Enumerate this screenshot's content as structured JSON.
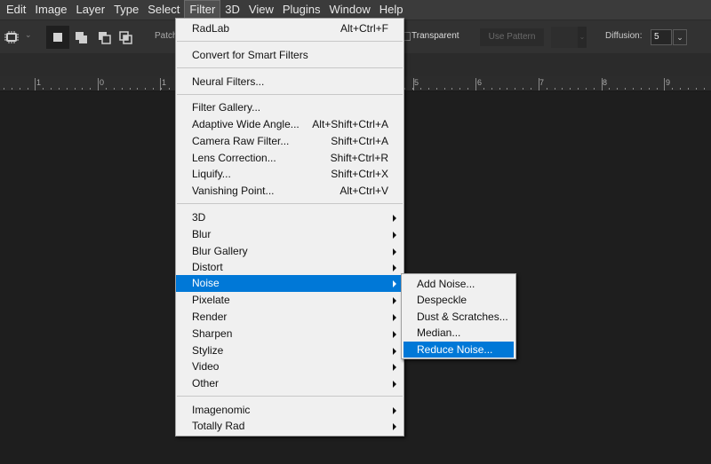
{
  "menubar": {
    "items": [
      "Edit",
      "Image",
      "Layer",
      "Type",
      "Select",
      "Filter",
      "3D",
      "View",
      "Plugins",
      "Window",
      "Help"
    ],
    "active": "Filter"
  },
  "options_bar": {
    "tool_icon": "patch-tool-icon",
    "selection_modes": [
      "new-selection",
      "add-to-selection",
      "subtract-from-selection",
      "intersect-with-selection"
    ],
    "patch_label": "Patch",
    "transparent_label": "Transparent",
    "transparent_checked": false,
    "use_pattern_label": "Use Pattern",
    "diffusion_label": "Diffusion:",
    "diffusion_value": "5"
  },
  "ruler": {
    "labels": [
      "1",
      "0",
      "1",
      "5",
      "6",
      "7",
      "8",
      "9"
    ]
  },
  "filter_menu": {
    "items": [
      {
        "label": "RadLab",
        "shortcut": "Alt+Ctrl+F"
      },
      {
        "separator": true
      },
      {
        "label": "Convert for Smart Filters",
        "shortcut": ""
      },
      {
        "separator": true
      },
      {
        "label": "Neural Filters...",
        "shortcut": ""
      },
      {
        "separator": true
      },
      {
        "label": "Filter Gallery...",
        "shortcut": ""
      },
      {
        "label": "Adaptive Wide Angle...",
        "shortcut": "Alt+Shift+Ctrl+A"
      },
      {
        "label": "Camera Raw Filter...",
        "shortcut": "Shift+Ctrl+A"
      },
      {
        "label": "Lens Correction...",
        "shortcut": "Shift+Ctrl+R"
      },
      {
        "label": "Liquify...",
        "shortcut": "Shift+Ctrl+X"
      },
      {
        "label": "Vanishing Point...",
        "shortcut": "Alt+Ctrl+V"
      },
      {
        "separator": true
      },
      {
        "label": "3D",
        "submenu": true
      },
      {
        "label": "Blur",
        "submenu": true
      },
      {
        "label": "Blur Gallery",
        "submenu": true
      },
      {
        "label": "Distort",
        "submenu": true
      },
      {
        "label": "Noise",
        "submenu": true,
        "highlighted": true
      },
      {
        "label": "Pixelate",
        "submenu": true
      },
      {
        "label": "Render",
        "submenu": true
      },
      {
        "label": "Sharpen",
        "submenu": true
      },
      {
        "label": "Stylize",
        "submenu": true
      },
      {
        "label": "Video",
        "submenu": true
      },
      {
        "label": "Other",
        "submenu": true
      },
      {
        "separator": true
      },
      {
        "label": "Imagenomic",
        "submenu": true
      },
      {
        "label": "Totally Rad",
        "submenu": true
      }
    ]
  },
  "noise_submenu": {
    "items": [
      {
        "label": "Add Noise..."
      },
      {
        "label": "Despeckle"
      },
      {
        "label": "Dust & Scratches..."
      },
      {
        "label": "Median..."
      },
      {
        "label": "Reduce Noise...",
        "highlighted": true
      }
    ]
  },
  "colors": {
    "highlight": "#0078d7",
    "menu_bg": "#f0f0f0",
    "app_bg": "#1e1e1e"
  }
}
